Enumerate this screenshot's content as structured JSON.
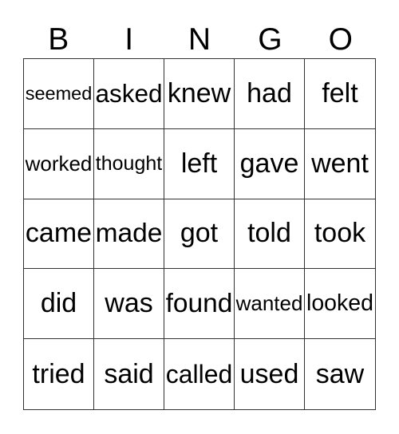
{
  "header": [
    "B",
    "I",
    "N",
    "G",
    "O"
  ],
  "cells": [
    "seemed",
    "asked",
    "knew",
    "had",
    "felt",
    "worked",
    "thought",
    "left",
    "gave",
    "went",
    "came",
    "made",
    "got",
    "told",
    "took",
    "did",
    "was",
    "found",
    "wanted",
    "looked",
    "tried",
    "said",
    "called",
    "used",
    "saw"
  ]
}
